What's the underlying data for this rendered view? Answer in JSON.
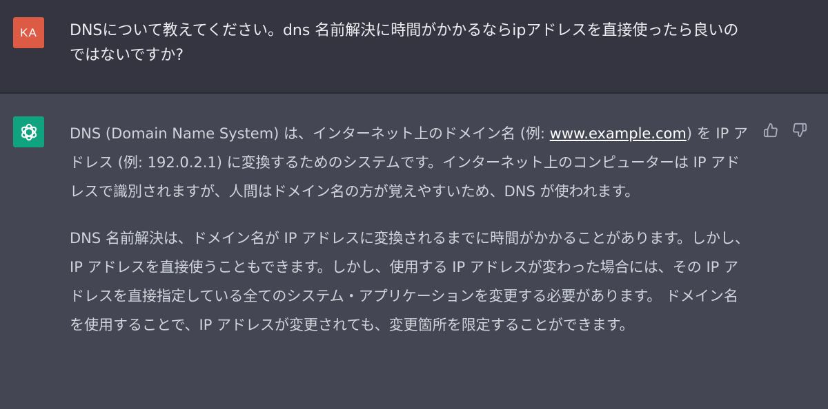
{
  "user": {
    "avatar_initials": "KA",
    "message": "DNSについて教えてください。dns 名前解決に時間がかかるならipアドレスを直接使ったら良いのではないですか?"
  },
  "assistant": {
    "avatar_icon": "openai-logo-icon",
    "paragraph1": {
      "part1": "DNS (Domain Name System) は、インターネット上のドメイン名 (例: ",
      "link": "www.example.com",
      "part2": ") を IP アドレス (例: 192.0.2.1) に変換するためのシステムです。インターネット上のコンピューターは IP アドレスで識別されますが、人間はドメイン名の方が覚えやすいため、DNS が使われます。"
    },
    "paragraph2": "DNS 名前解決は、ドメイン名が IP アドレスに変換されるまでに時間がかかることがあります。しかし、IP アドレスを直接使うこともできます。しかし、使用する IP アドレスが変わった場合には、その IP アドレスを直接指定している全てのシステム・アプリケーションを変更する必要があります。 ドメイン名を使用することで、IP アドレスが変更されても、変更箇所を限定することができます。",
    "feedback": {
      "up_icon": "thumbs-up-icon",
      "down_icon": "thumbs-down-icon"
    }
  },
  "colors": {
    "user_background": "#343541",
    "assistant_background": "#444654",
    "user_avatar": "#dd5b45",
    "assistant_avatar": "#10a37f"
  }
}
